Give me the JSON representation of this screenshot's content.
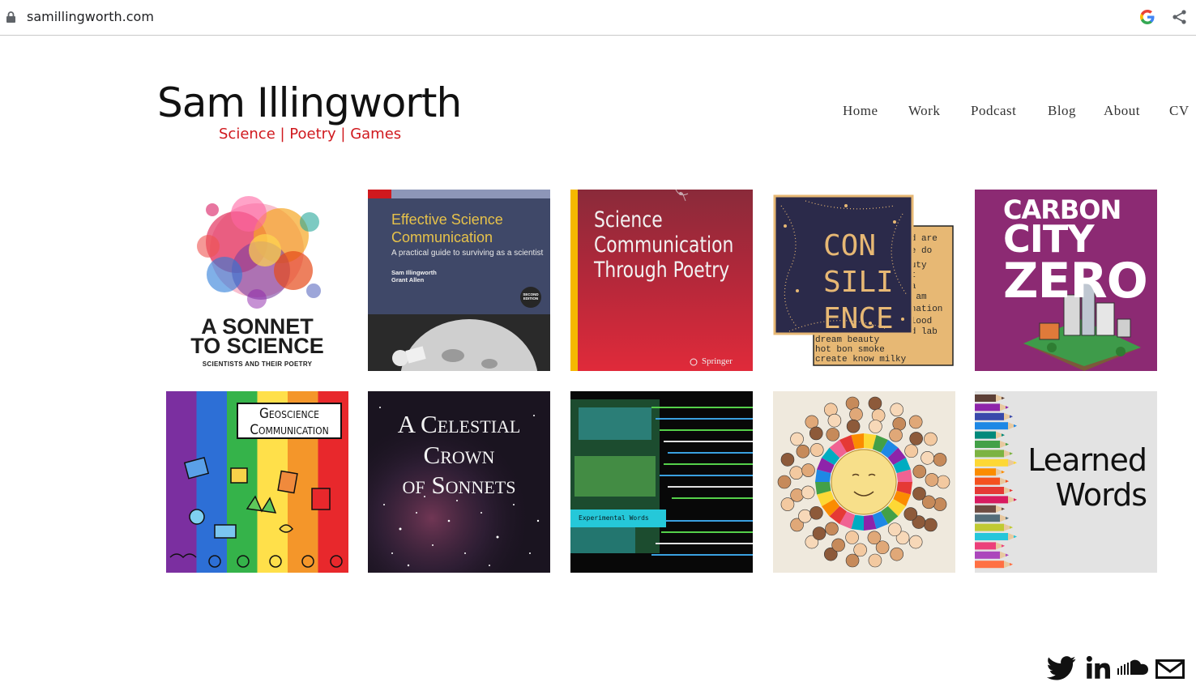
{
  "browser": {
    "url": "samillingworth.com",
    "icons": [
      "lock-icon",
      "google-icon",
      "share-icon"
    ]
  },
  "site": {
    "title": "Sam Illingworth",
    "tagline": "Science | Poetry | Games"
  },
  "nav": {
    "items": [
      {
        "label": "Home"
      },
      {
        "label": "Work"
      },
      {
        "label": "Podcast"
      },
      {
        "label": "Blog"
      },
      {
        "label": "About"
      },
      {
        "label": "CV"
      }
    ]
  },
  "tiles": [
    {
      "line1": "A SONNET",
      "line2": "TO SCIENCE",
      "sub": "SCIENTISTS AND THEIR POETRY"
    },
    {
      "line1": "Effective Science",
      "line2": "Communication",
      "sub": "A practical guide to surviving as a scientist",
      "author1": "Sam Illingworth",
      "author2": "Grant Allen",
      "badge1": "SECOND",
      "badge2": "EDITION"
    },
    {
      "line1": "Science",
      "line2": "Communication",
      "line3": "Through Poetry",
      "publisher": "Springer"
    },
    {
      "line1": "CON",
      "line2": "SILI",
      "line3": "ENCE"
    },
    {
      "line1": "CARBON",
      "line2": "CITY",
      "line3": "ZERO"
    },
    {
      "line1": "Geoscience",
      "line2": "Communication"
    },
    {
      "line1": "A Celestial",
      "line2": "Crown",
      "line3": "of Sonnets"
    },
    {
      "tag": "Experimental Words"
    },
    {},
    {
      "line1": "Learned",
      "line2": "Words"
    }
  ],
  "social": [
    "twitter-icon",
    "linkedin-icon",
    "soundcloud-icon",
    "email-icon"
  ],
  "colors": {
    "accent": "#d0191e",
    "text": "#111111",
    "nav": "#333333"
  }
}
